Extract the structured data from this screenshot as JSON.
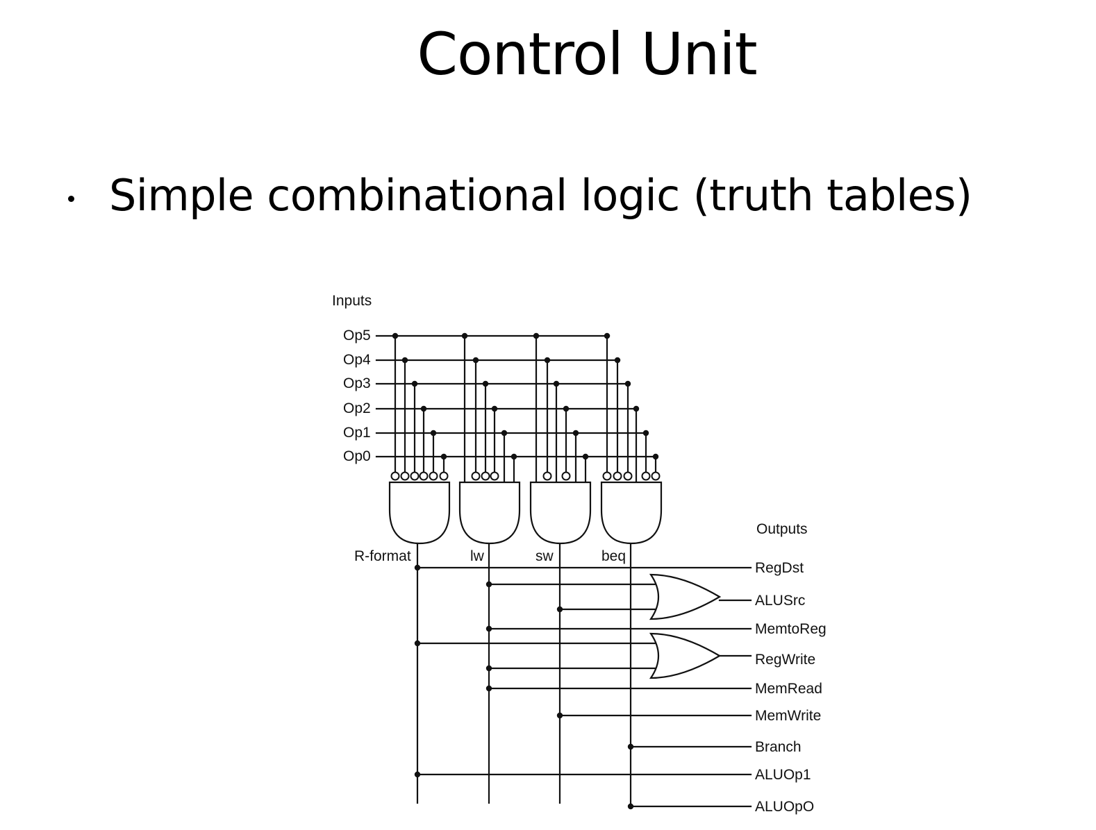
{
  "slide": {
    "title": "Control Unit",
    "bullet": "Simple combinational logic (truth tables)"
  },
  "diagram": {
    "inputs_label": "Inputs",
    "outputs_label": "Outputs",
    "inputs": [
      "Op5",
      "Op4",
      "Op3",
      "Op2",
      "Op1",
      "Op0"
    ],
    "decoders": [
      {
        "label": "R-format",
        "bubbles": [
          true,
          true,
          true,
          true,
          true,
          true
        ]
      },
      {
        "label": "lw",
        "bubbles": [
          false,
          true,
          true,
          true,
          false,
          false
        ]
      },
      {
        "label": "sw",
        "bubbles": [
          false,
          true,
          false,
          true,
          false,
          false
        ]
      },
      {
        "label": "beq",
        "bubbles": [
          true,
          true,
          true,
          false,
          true,
          true
        ]
      }
    ],
    "outputs": [
      "RegDst",
      "ALUSrc",
      "MemtoReg",
      "RegWrite",
      "MemRead",
      "MemWrite",
      "Branch",
      "ALUOp1",
      "ALUOpO"
    ]
  }
}
